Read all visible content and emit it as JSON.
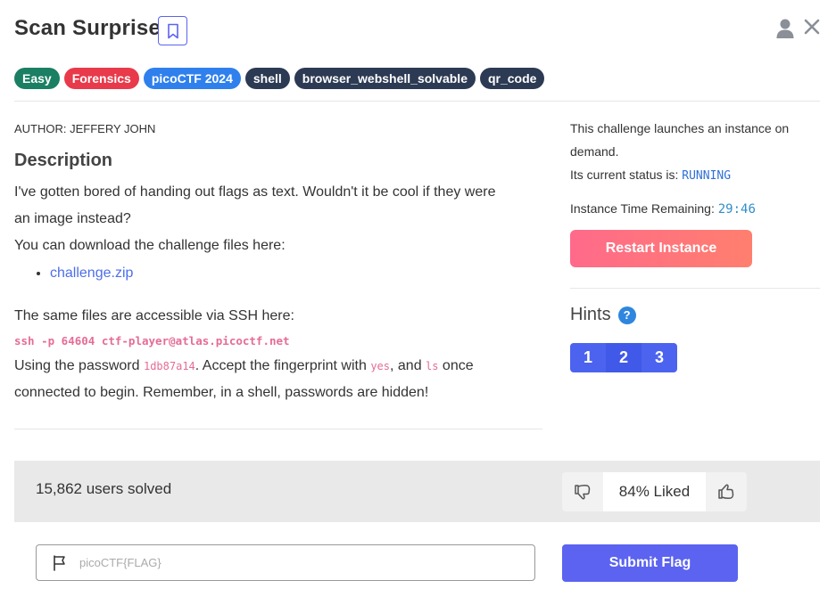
{
  "challenge": {
    "title": "Scan Surprise",
    "tags": [
      {
        "label": "Easy",
        "color": "#1a7f63"
      },
      {
        "label": "Forensics",
        "color": "#e83a4a"
      },
      {
        "label": "picoCTF 2024",
        "color": "#2f80ed"
      },
      {
        "label": "shell",
        "color": "#2c3a54"
      },
      {
        "label": "browser_webshell_solvable",
        "color": "#2c3a54"
      },
      {
        "label": "qr_code",
        "color": "#2c3a54"
      }
    ],
    "author": "AUTHOR: JEFFERY JOHN",
    "description_heading": "Description",
    "description_lines": [
      "I've gotten bored of handing out flags as text. Wouldn't it be cool if they were",
      "an image instead?"
    ],
    "download_text": "You can download the challenge files here:",
    "files": [
      "challenge.zip"
    ],
    "ssh_intro": "The same files are accessible via SSH here:",
    "ssh_command": "ssh -p 64604 ctf-player@atlas.picoctf.net",
    "password_prefix": "Using the password ",
    "password": "1db87a14",
    "password_mid": ". Accept the fingerprint with ",
    "fingerprint_cmd": "yes",
    "and_text": ", and ",
    "ls_cmd": "ls",
    "password_suffix": " once",
    "final_line": "connected to begin. Remember, in a shell, passwords are hidden!"
  },
  "instance": {
    "launch_text": "This challenge launches an instance on demand.",
    "status_label": "Its current status is: ",
    "status": "RUNNING",
    "time_label": "Instance Time Remaining: ",
    "time_remaining": "29:46",
    "restart_label": "Restart Instance"
  },
  "hints": {
    "heading": "Hints",
    "help_glyph": "?",
    "buttons": [
      "1",
      "2",
      "3"
    ]
  },
  "stats": {
    "solved": "15,862 users solved",
    "liked": "84% Liked"
  },
  "flag_form": {
    "placeholder": "picoCTF{FLAG}",
    "submit_label": "Submit Flag"
  },
  "icons": {
    "bookmark": "bookmark-icon",
    "user": "user-icon",
    "close": "close-icon",
    "help": "question-circle-icon",
    "thumbs_down": "thumbs-down-icon",
    "thumbs_up": "thumbs-up-icon",
    "flag": "flag-icon"
  },
  "colors": {
    "accent": "#5b63f0",
    "restart_gradient_start": "#ff6a8a",
    "restart_gradient_end": "#ff7f6e",
    "code_pink": "#e56c97",
    "status_blue": "#2f6fd6"
  }
}
